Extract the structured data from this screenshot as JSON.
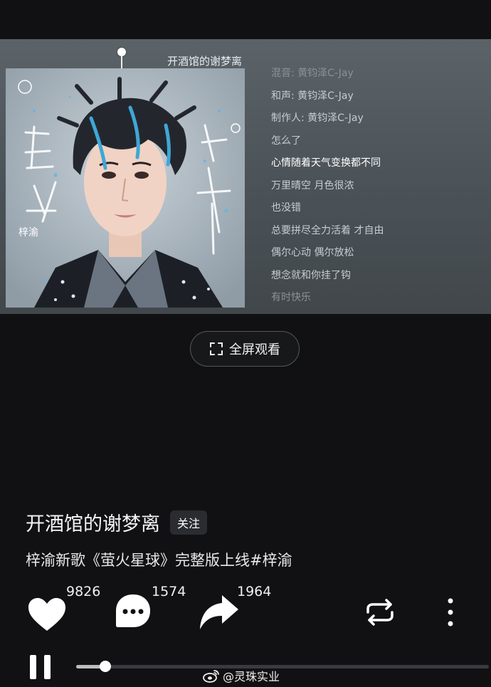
{
  "video": {
    "uploader_tag": "开酒馆的谢梦离",
    "lyrics": [
      {
        "text": "混音: 黄钧泽C-Jay",
        "state": "dim"
      },
      {
        "text": "和声: 黄钧泽C-Jay",
        "state": "normal"
      },
      {
        "text": "制作人: 黄钧泽C-Jay",
        "state": "normal"
      },
      {
        "text": "怎么了",
        "state": "normal"
      },
      {
        "text": "心情随着天气变换都不同",
        "state": "active"
      },
      {
        "text": "万里晴空 月色很浓",
        "state": "normal"
      },
      {
        "text": "也没错",
        "state": "normal"
      },
      {
        "text": "总要拼尽全力活着 才自由",
        "state": "normal"
      },
      {
        "text": "偶尔心动 偶尔放松",
        "state": "normal"
      },
      {
        "text": "想念就和你挂了钩",
        "state": "normal"
      },
      {
        "text": "有时快乐",
        "state": "dim"
      }
    ],
    "fullscreen_label": "全屏观看"
  },
  "post": {
    "author": "开酒馆的谢梦离",
    "follow_label": "关注",
    "caption": "梓渝新歌《萤火星球》完整版上线#梓渝"
  },
  "actions": {
    "likes": "9826",
    "comments": "1574",
    "shares": "1964"
  },
  "player": {
    "progress_fraction": 0.07
  },
  "watermark": "@灵珠实业",
  "colors": {
    "background": "#111113",
    "card": "#4b5257",
    "accent_hair": "#3fa7d6"
  }
}
